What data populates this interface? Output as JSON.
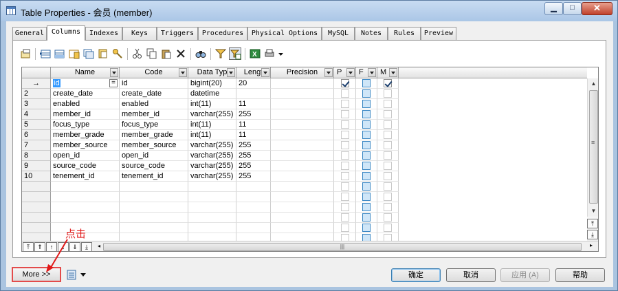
{
  "window": {
    "title": "Table Properties - 会员 (member)"
  },
  "tabs": [
    "General",
    "Columns",
    "Indexes",
    "Keys",
    "Triggers",
    "Procedures",
    "Physical Options",
    "MySQL",
    "Notes",
    "Rules",
    "Preview"
  ],
  "active_tab": "Columns",
  "grid": {
    "headers": [
      "Name",
      "Code",
      "Data Typ",
      "Lengt",
      "Precision",
      "P",
      "F",
      "M"
    ],
    "rows": [
      {
        "num": "→",
        "name": "id",
        "code": "id",
        "type": "bigint(20)",
        "length": "20",
        "precision": "",
        "p": true,
        "f": false,
        "m": true
      },
      {
        "num": "2",
        "name": "create_date",
        "code": "create_date",
        "type": "datetime",
        "length": "",
        "precision": "",
        "p": false,
        "f": false,
        "m": false
      },
      {
        "num": "3",
        "name": "enabled",
        "code": "enabled",
        "type": "int(11)",
        "length": "11",
        "precision": "",
        "p": false,
        "f": false,
        "m": false
      },
      {
        "num": "4",
        "name": "member_id",
        "code": "member_id",
        "type": "varchar(255)",
        "length": "255",
        "precision": "",
        "p": false,
        "f": false,
        "m": false
      },
      {
        "num": "5",
        "name": "focus_type",
        "code": "focus_type",
        "type": "int(11)",
        "length": "11",
        "precision": "",
        "p": false,
        "f": false,
        "m": false
      },
      {
        "num": "6",
        "name": "member_grade",
        "code": "member_grade",
        "type": "int(11)",
        "length": "11",
        "precision": "",
        "p": false,
        "f": false,
        "m": false
      },
      {
        "num": "7",
        "name": "member_source",
        "code": "member_source",
        "type": "varchar(255)",
        "length": "255",
        "precision": "",
        "p": false,
        "f": false,
        "m": false
      },
      {
        "num": "8",
        "name": "open_id",
        "code": "open_id",
        "type": "varchar(255)",
        "length": "255",
        "precision": "",
        "p": false,
        "f": false,
        "m": false
      },
      {
        "num": "9",
        "name": "source_code",
        "code": "source_code",
        "type": "varchar(255)",
        "length": "255",
        "precision": "",
        "p": false,
        "f": false,
        "m": false
      },
      {
        "num": "10",
        "name": "tenement_id",
        "code": "tenement_id",
        "type": "varchar(255)",
        "length": "255",
        "precision": "",
        "p": false,
        "f": false,
        "m": false
      }
    ],
    "equals_marker": "=",
    "empty_rows": 6
  },
  "buttons": {
    "more": "More >>",
    "ok": "确定",
    "cancel": "取消",
    "apply": "应用 (A)",
    "help": "帮助"
  },
  "annotation": {
    "text": "点击",
    "color": "#e11919"
  }
}
